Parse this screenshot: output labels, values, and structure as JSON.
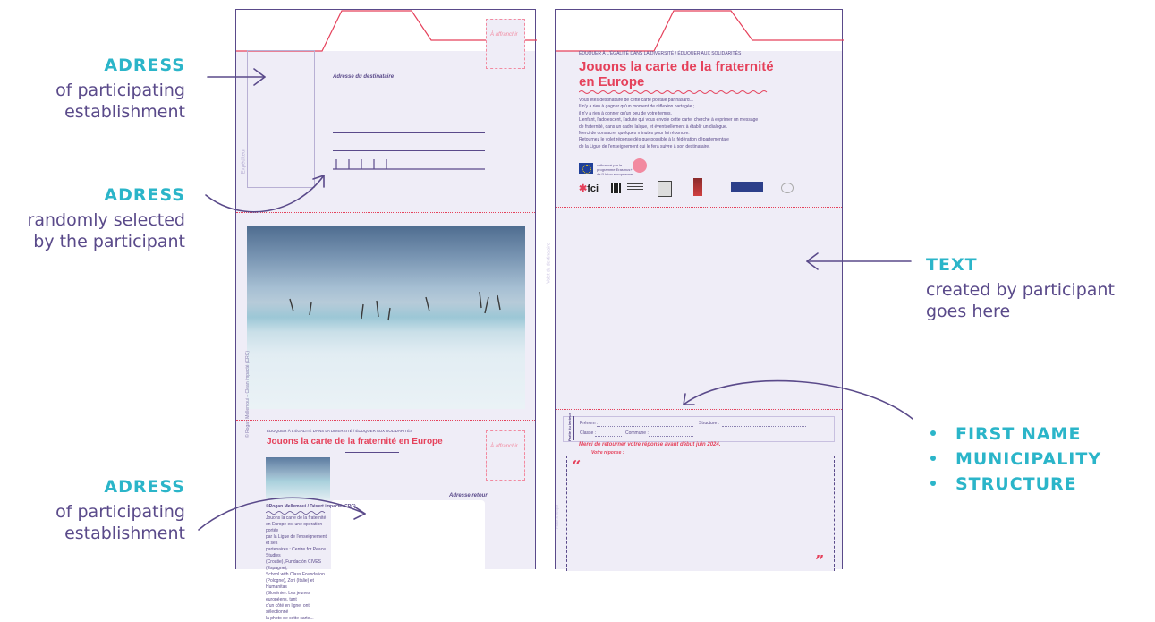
{
  "annotations": {
    "adress1": {
      "title": "ADRESS",
      "lines": [
        "of participating",
        "establishment"
      ]
    },
    "adress2": {
      "title": "ADRESS",
      "lines": [
        "randomly selected",
        "by the participant"
      ]
    },
    "adress3": {
      "title": "ADRESS",
      "lines": [
        "of participating",
        "establishment"
      ]
    },
    "text": {
      "title": "TEXT",
      "lines": [
        "created by participant",
        "goes here"
      ]
    },
    "bullets": [
      "FIRST NAME",
      "MUNICIPALITY",
      "STRUCTURE"
    ]
  },
  "left_card": {
    "stamp_label": "À affranchir",
    "address_heading": "Adresse du destinataire",
    "sender_label": "Expéditeur",
    "photo_credit": "© Rogan Mellemoui – Clean impacté (CRC)",
    "subhead": "ÉDUQUER À L'ÉGALITÉ DANS LA DIVERSITÉ / ÉDUQUER AUX SOLIDARITÉS",
    "title": "Jouons la carte de la fraternité en Europe",
    "stamp_label_2": "À affranchir",
    "return_address": "Adresse retour",
    "small_credit": "©Rogan Mellemoui / Désert impacté (CRC)",
    "small_text": [
      "Jouons la carte de la fraternité",
      "en Europe est une opération portée",
      "par la Ligue de l'enseignement et ses",
      "partenaires : Centre for Peace Studies",
      "(Croatie), Fundación CIVES (Espagne),",
      "School with Class Foundation",
      "(Pologne), Zori (Italie) et Humanitas",
      "(Slovénie). Les jeunes européens, tant",
      "d'un côté en ligne, ont sélectionné",
      "la photo de cette carte..."
    ]
  },
  "right_card": {
    "subhead": "ÉDUQUER À L'ÉGALITÉ DANS LA DIVERSITÉ / ÉDUQUER AUX SOLIDARITÉS",
    "title_line1": "Jouons la carte de la fraternité",
    "title_line2": "en Europe",
    "intro": [
      "Vous êtes destinataire de cette carte postale par hasard...",
      "Il n'y a rien à gagner qu'un moment de réflexion partagée ;",
      "il n'y a rien à donner qu'un peu de votre temps.",
      "L'enfant, l'adolescent, l'adulte qui vous envoie cette carte, cherche à exprimer un message",
      "de fraternité, dans un cadre laïque, et éventuellement à établir un dialogue.",
      "Merci de consacrer quelques minutes pour lui répondre.",
      "Retournez le volet réponse dès que possible à la fédération départementale",
      "de la Ligue de l'enseignement qui le fera suivre à son destinataire."
    ],
    "eu_text": "cofinancé par le programme Erasmus+ de l'Union européenne",
    "logo_fci": "fci",
    "side_label": "Volet du destinataire",
    "form_side": "Partie du lecteur",
    "prenom": "Prénom :",
    "structure": "Structure :",
    "classe": "Classe :",
    "commune": "Commune :",
    "return_note": "Merci de retourner votre réponse avant début juin 2024.",
    "reply_label": "Votre réponse :",
    "quote_open": "“",
    "quote_close": "”",
    "reply_side": "Partie à remplir"
  },
  "colors": {
    "accent": "#2bb5c9",
    "purple": "#5a4a8a",
    "pink": "#e5415b",
    "card": "#efedf7"
  }
}
